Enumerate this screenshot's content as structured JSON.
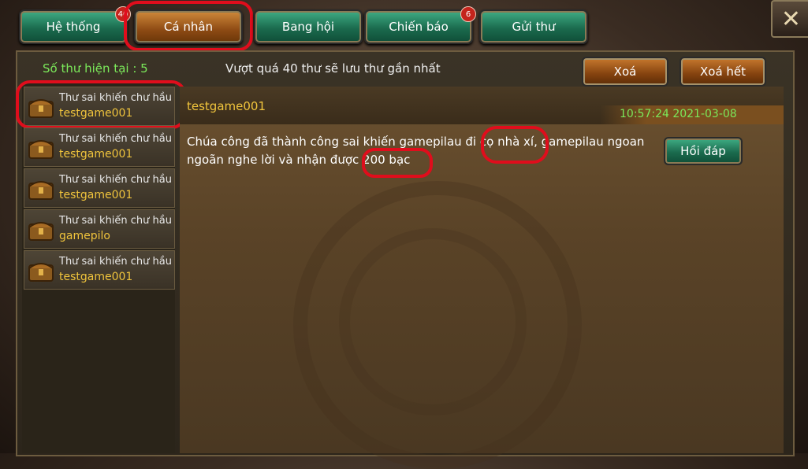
{
  "tabs": [
    {
      "label": "Hệ thống",
      "badge": "40"
    },
    {
      "label": "Cá nhân",
      "badge": ""
    },
    {
      "label": "Bang hội",
      "badge": ""
    },
    {
      "label": "Chiến báo",
      "badge": "6"
    },
    {
      "label": "Gửi thư",
      "badge": ""
    }
  ],
  "toolbar": {
    "mail_count": "Số thư hiện tại : 5",
    "limit_note": "Vượt quá 40 thư sẽ lưu thư gần nhất",
    "delete_label": "Xoá",
    "delete_all_label": "Xoá hết"
  },
  "mail_list": [
    {
      "subject": "Thư sai khiến chư hầu",
      "sender": "testgame001"
    },
    {
      "subject": "Thư sai khiến chư hầu",
      "sender": "testgame001"
    },
    {
      "subject": "Thư sai khiến chư hầu",
      "sender": "testgame001"
    },
    {
      "subject": "Thư sai khiến chư hầu",
      "sender": "gamepilo"
    },
    {
      "subject": "Thư sai khiến chư hầu",
      "sender": "testgame001"
    }
  ],
  "detail": {
    "sender": "testgame001",
    "timestamp": "10:57:24 2021-03-08",
    "body": "Chúa công đã thành công sai khiến gamepilau đi cọ nhà xí, gamepilau ngoan ngoãn nghe lời và nhận được 200 bạc",
    "reply_label": "Hồi đáp"
  },
  "colors": {
    "green_text": "#7be85a",
    "gold_text": "#f0c43c",
    "highlight_ring": "#e00d1c"
  },
  "icons": {
    "close": "close-x-icon",
    "mail_item": "treasure-chest-icon"
  }
}
